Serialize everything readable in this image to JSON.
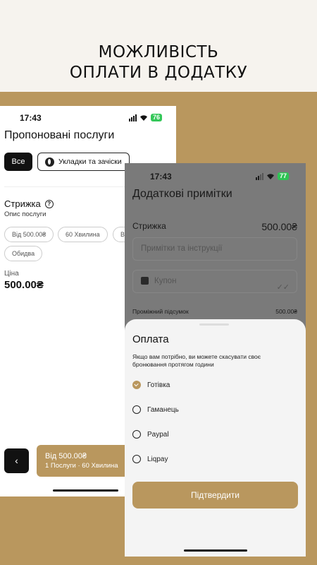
{
  "headline": {
    "line1": "МОЖЛИВІСТЬ",
    "line2": "ОПЛАТИ В ДОДАТКУ"
  },
  "colors": {
    "brand": "#b9975e",
    "background": "#f6f3ee",
    "dark": "#111111"
  },
  "left_screen": {
    "status": {
      "time": "17:43",
      "battery": "76"
    },
    "title": "Пропоновані послуги",
    "tabs": [
      {
        "label": "Все",
        "active": true
      },
      {
        "label": "Укладки та зачіски",
        "active": false,
        "icon": "leaf-icon"
      }
    ],
    "service": {
      "name": "Стрижка",
      "description": "Опис послуги",
      "chips": [
        "Від 500.00₴",
        "60 Хвилина",
        "В",
        "Обидва"
      ],
      "price_label": "Ціна",
      "price_value": "500.00₴"
    },
    "back_label": "‹",
    "bottom_bar": {
      "line1": "Від 500.00₴",
      "line2": "1 Послуги · 60 Хвилина"
    }
  },
  "right_screen": {
    "status": {
      "time": "17:43",
      "battery": "77"
    },
    "title": "Додаткові примітки",
    "service_row": {
      "name": "Стрижка",
      "value": "500.00₴"
    },
    "notes_placeholder": "Примітки та інструкції",
    "coupon_placeholder": "Купон",
    "subtotal": {
      "label": "Проміжний підсумок",
      "value": "500.00₴"
    },
    "payment_sheet": {
      "title": "Оплата",
      "note": "Якщо вам потрібно, ви можете скасувати своє бронювання протягом години",
      "options": [
        {
          "label": "Готівка",
          "selected": true
        },
        {
          "label": "Гаманець",
          "selected": false
        },
        {
          "label": "Paypal",
          "selected": false
        },
        {
          "label": "Liqpay",
          "selected": false
        }
      ],
      "confirm_label": "Підтвердити"
    }
  }
}
